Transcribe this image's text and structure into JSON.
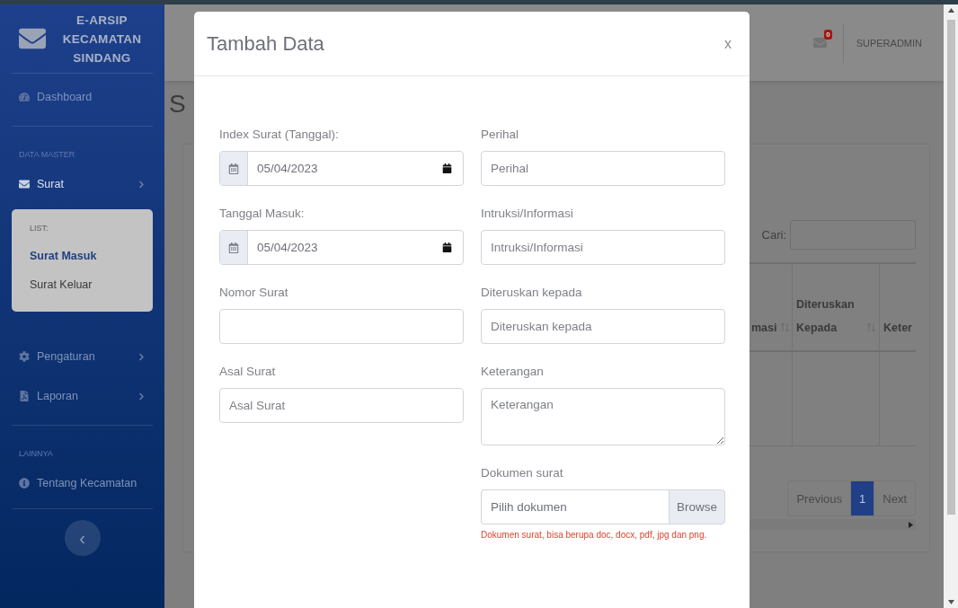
{
  "sidebar": {
    "brand": [
      "E-ARSIP",
      "KECAMATAN",
      "SINDANG"
    ],
    "sections": [
      {
        "items": [
          {
            "label": "Dashboard",
            "selected": false
          }
        ]
      },
      {
        "heading": "DATA MASTER",
        "items": [
          {
            "kind": "dropdown",
            "label": "Surat",
            "selected": true,
            "submenu": {
              "heading": "LIST:",
              "items": [
                {
                  "label": "Surat Masuk",
                  "selected": true
                },
                {
                  "label": "Surat Keluar",
                  "selected": false
                }
              ]
            }
          },
          {
            "kind": "dropdown",
            "label": "Pengaturan",
            "selected": false
          },
          {
            "kind": "dropdown",
            "label": "Laporan",
            "selected": false
          }
        ]
      },
      {
        "heading": "LAINNYA",
        "items": [
          {
            "label": "Tentang Kecamatan",
            "selected": false
          }
        ]
      }
    ],
    "toggle": "‹"
  },
  "topbar": {
    "notifications": "0",
    "user": "SUPERADMIN"
  },
  "page": {
    "title": "S"
  },
  "card": {
    "search_label": "Cari:",
    "columns": [
      {
        "label": "masi"
      },
      {
        "label": "Diteruskan Kepada"
      },
      {
        "label": "Keter"
      }
    ],
    "pagination": [
      {
        "label": "Previous",
        "selected": false
      },
      {
        "label": "1",
        "selected": true
      },
      {
        "label": "Next",
        "selected": false
      }
    ]
  },
  "modal": {
    "title": "Tambah Data",
    "close": "x",
    "columns": [
      [
        {
          "kind": "date",
          "label": "Index Surat (Tanggal):",
          "value": "05/04/2023"
        },
        {
          "kind": "date",
          "label": "Tanggal Masuk:",
          "value": "05/04/2023"
        },
        {
          "kind": "text",
          "label": "Nomor Surat"
        },
        {
          "kind": "text",
          "label": "Asal Surat",
          "placeholder": "Asal Surat"
        }
      ],
      [
        {
          "kind": "text",
          "label": "Perihal",
          "placeholder": "Perihal"
        },
        {
          "kind": "text",
          "label": "Intruksi/Informasi",
          "placeholder": "Intruksi/Informasi"
        },
        {
          "kind": "text",
          "label": "Diteruskan kepada",
          "placeholder": "Diteruskan kepada"
        },
        {
          "kind": "textarea",
          "label": "Keterangan",
          "placeholder": "Keterangan"
        },
        {
          "kind": "file",
          "label": "Dokumen surat",
          "placeholder": "Pilih dokumen",
          "button": "Browse",
          "help": "Dokumen surat, bisa berupa doc, docx, pdf, jpg dan png."
        }
      ]
    ]
  }
}
